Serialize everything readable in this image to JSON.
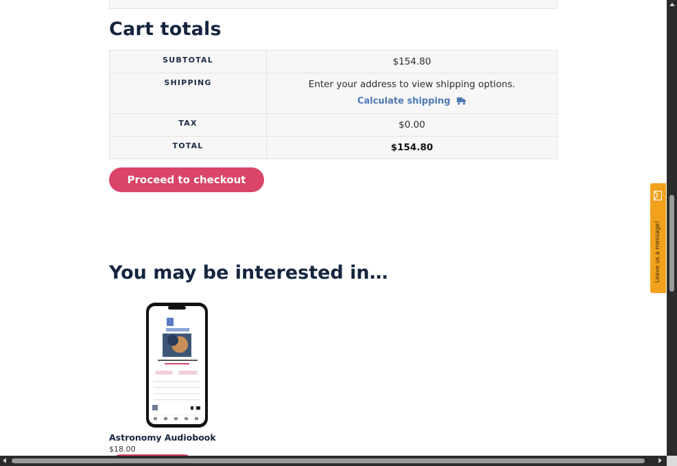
{
  "cart_totals": {
    "title": "Cart totals",
    "subtotal_label": "SUBTOTAL",
    "subtotal_value": "$154.80",
    "shipping_label": "SHIPPING",
    "shipping_text": "Enter your address to view shipping options.",
    "calculate_shipping": "Calculate shipping",
    "tax_label": "TAX",
    "tax_value": "$0.00",
    "total_label": "TOTAL",
    "total_value": "$154.80",
    "checkout_button": "Proceed to checkout"
  },
  "recommendations": {
    "title": "You may be interested in…",
    "products": [
      {
        "name": "Astronomy Audiobook",
        "price": "$18.00"
      }
    ]
  },
  "chat_widget": {
    "label": "Leave us a message!"
  },
  "colors": {
    "accent": "#d94468",
    "heading": "#15253f",
    "link": "#4c78b5",
    "chat_tab": "#f2a11c"
  }
}
